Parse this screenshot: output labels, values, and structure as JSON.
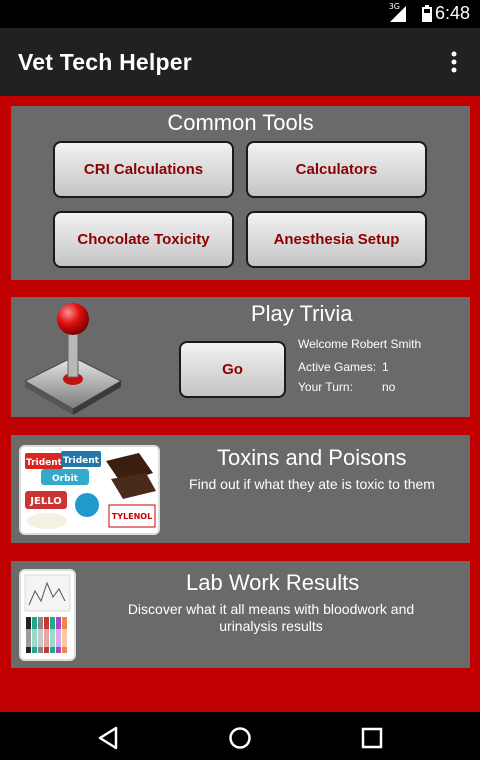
{
  "status_bar": {
    "network": "3G",
    "time": "6:48"
  },
  "app_bar": {
    "title": "Vet Tech Helper",
    "overflow_icon": "more-vert-icon"
  },
  "common_tools": {
    "title": "Common Tools",
    "buttons": [
      "CRI Calculations",
      "Calculators",
      "Chocolate Toxicity",
      "Anesthesia Setup"
    ]
  },
  "trivia": {
    "title": "Play Trivia",
    "go_label": "Go",
    "welcome": "Welcome Robert Smith",
    "active_games_label": "Active Games:",
    "active_games_value": "1",
    "your_turn_label": "Your Turn:",
    "your_turn_value": "no",
    "icon": "joystick-icon"
  },
  "toxins": {
    "title": "Toxins and Poisons",
    "description": "Find out if what they ate is toxic to them",
    "image": "toxins-products-image",
    "image_labels": [
      "Trident",
      "Trident",
      "Orbit",
      "JELLO",
      "TYLENOL"
    ]
  },
  "lab": {
    "title": "Lab Work Results",
    "description": "Discover what it all means with bloodwork and urinalysis results",
    "image": "lab-tubes-image"
  },
  "nav_bar": {
    "back": "back-icon",
    "home": "home-icon",
    "recents": "recents-icon"
  },
  "colors": {
    "background": "#c00000",
    "panel": "#6a6a6a",
    "button_text": "#8b0000",
    "app_bar": "#212121"
  }
}
